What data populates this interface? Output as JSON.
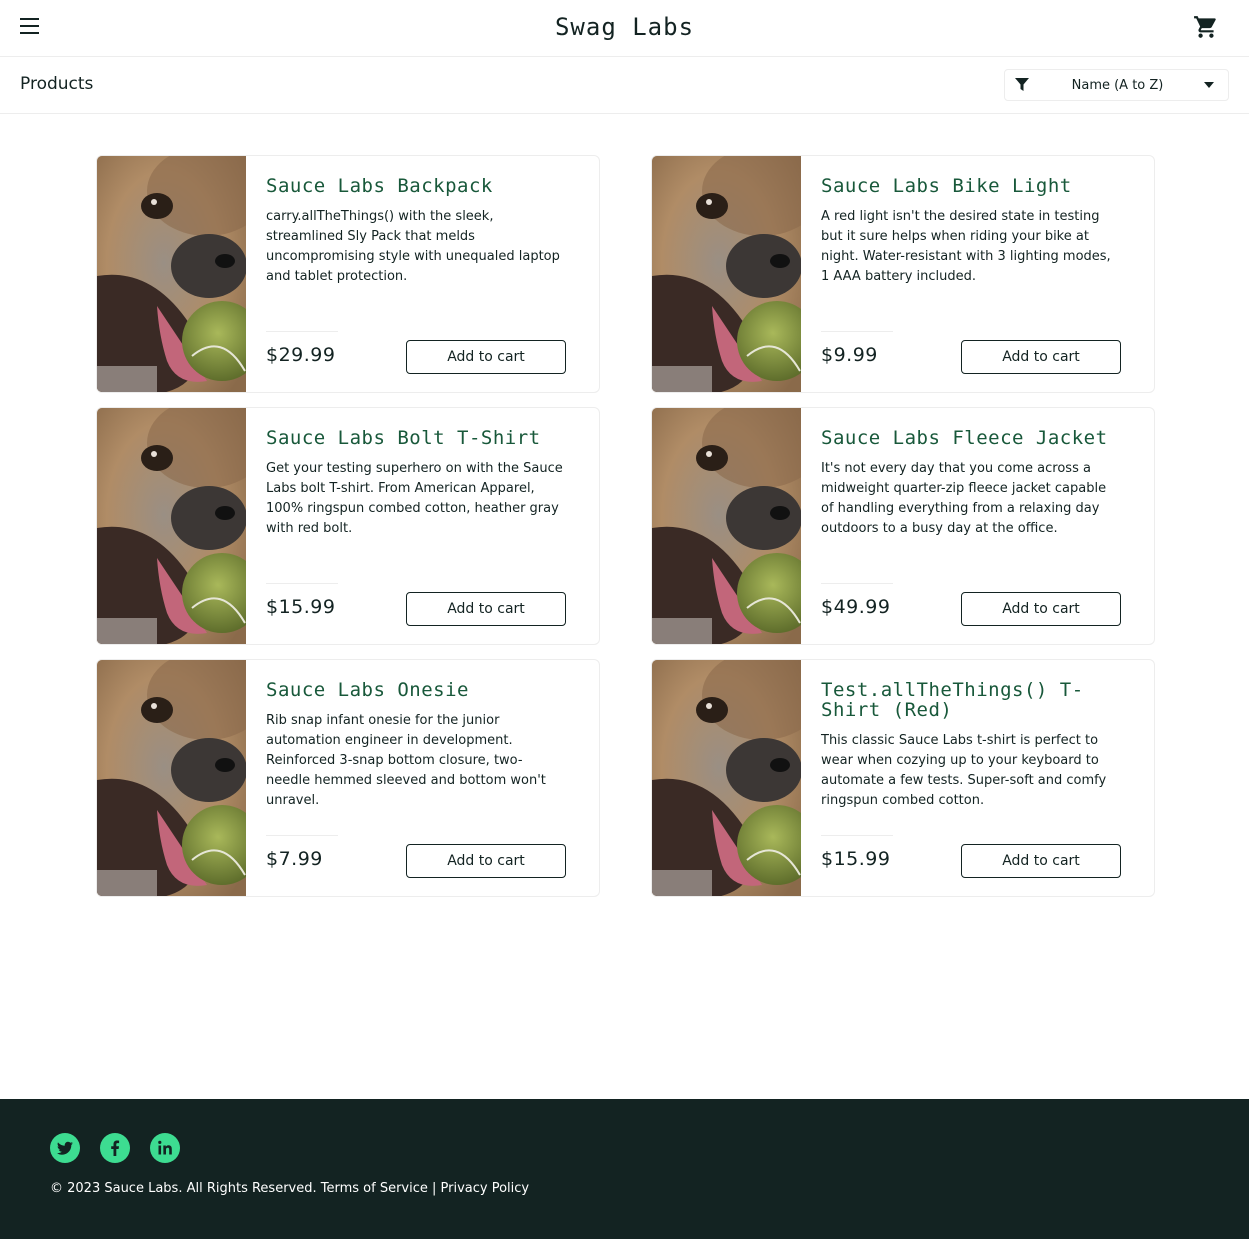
{
  "header": {
    "menu_icon": "hamburger-menu-icon",
    "app_logo": "Swag Labs",
    "cart_icon": "shopping-cart-icon"
  },
  "subheader": {
    "title": "Products",
    "sort": {
      "selected": "Name (A to Z)",
      "filter_icon": "filter-icon",
      "caret_icon": "caret-down-icon"
    }
  },
  "products": [
    {
      "name": "Sauce Labs Backpack",
      "description": "carry.allTheThings() with the sleek, streamlined Sly Pack that melds uncompromising style with unequaled laptop and tablet protection.",
      "price": "$29.99",
      "button": "Add to cart"
    },
    {
      "name": "Sauce Labs Bike Light",
      "description": "A red light isn't the desired state in testing but it sure helps when riding your bike at night. Water-resistant with 3 lighting modes, 1 AAA battery included.",
      "price": "$9.99",
      "button": "Add to cart"
    },
    {
      "name": "Sauce Labs Bolt T-Shirt",
      "description": "Get your testing superhero on with the Sauce Labs bolt T-shirt. From American Apparel, 100% ringspun combed cotton, heather gray with red bolt.",
      "price": "$15.99",
      "button": "Add to cart"
    },
    {
      "name": "Sauce Labs Fleece Jacket",
      "description": "It's not every day that you come across a midweight quarter-zip fleece jacket capable of handling everything from a relaxing day outdoors to a busy day at the office.",
      "price": "$49.99",
      "button": "Add to cart"
    },
    {
      "name": "Sauce Labs Onesie",
      "description": "Rib snap infant onesie for the junior automation engineer in development. Reinforced 3-snap bottom closure, two-needle hemmed sleeved and bottom won't unravel.",
      "price": "$7.99",
      "button": "Add to cart"
    },
    {
      "name": "Test.allTheThings() T-Shirt (Red)",
      "description": "This classic Sauce Labs t-shirt is perfect to wear when cozying up to your keyboard to automate a few tests. Super-soft and comfy ringspun combed cotton.",
      "price": "$15.99",
      "button": "Add to cart"
    }
  ],
  "footer": {
    "social_icons": [
      "twitter-icon",
      "facebook-icon",
      "linkedin-icon"
    ],
    "copy": "© 2023 Sauce Labs. All Rights Reserved. Terms of Service | Privacy Policy"
  },
  "colors": {
    "accent": "#3ddc91",
    "product_name": "#18583a",
    "text": "#132322",
    "footer_bg": "#132322"
  }
}
